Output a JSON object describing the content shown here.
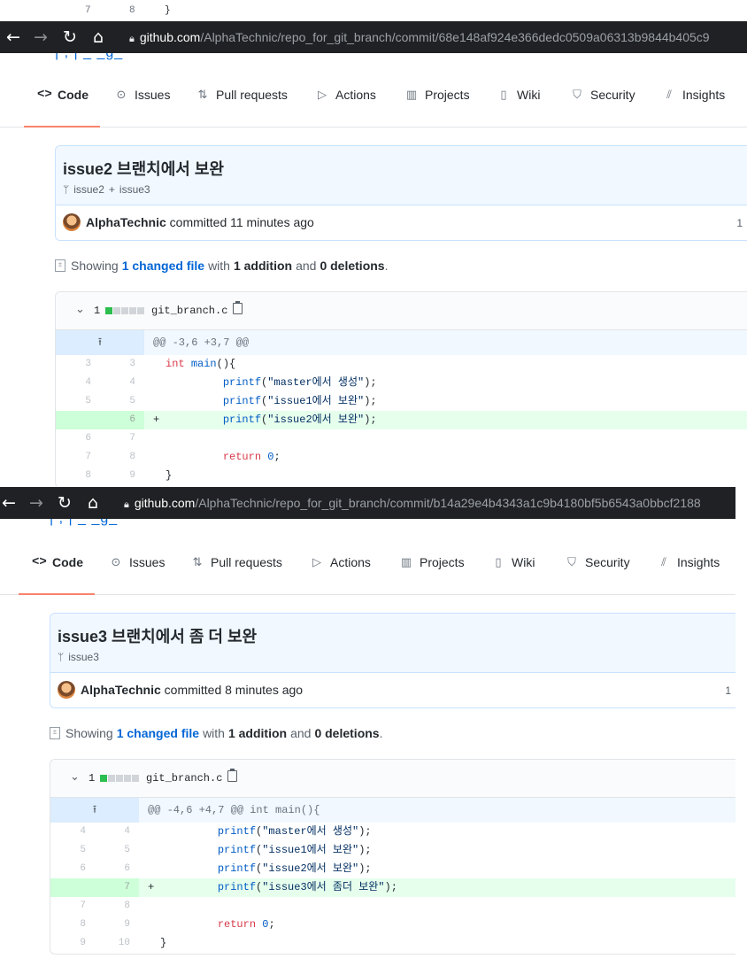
{
  "shot1": {
    "fragment": {
      "old_line": "7",
      "new_line": "8",
      "code": "}"
    },
    "browser": {
      "icons": [
        "back-arrow-icon",
        "forward-arrow-icon",
        "reload-icon",
        "home-icon",
        "lock-icon"
      ],
      "url_host": "github.com",
      "url_path": "/AlphaTechnic/repo_for_git_branch/commit/68e148af924e366dedc0509a06313b9844b405c9"
    },
    "tabs": [
      {
        "label": "Code",
        "icon": "code-icon"
      },
      {
        "label": "Issues",
        "icon": "issue-opened-icon"
      },
      {
        "label": "Pull requests",
        "icon": "git-pull-request-icon"
      },
      {
        "label": "Actions",
        "icon": "play-icon"
      },
      {
        "label": "Projects",
        "icon": "project-icon"
      },
      {
        "label": "Wiki",
        "icon": "book-icon"
      },
      {
        "label": "Security",
        "icon": "shield-icon"
      },
      {
        "label": "Insights",
        "icon": "graph-icon"
      }
    ],
    "commit": {
      "title": "issue2 브랜치에서 보완",
      "branches": [
        "issue2",
        "issue3"
      ],
      "branch_separator": "+",
      "author": "AlphaTechnic",
      "action": "committed",
      "time": "11 minutes ago",
      "parents": "1"
    },
    "summary": {
      "showing": "Showing",
      "changed": "1 changed file",
      "with": "with",
      "additions": "1 addition",
      "and": "and",
      "deletions": "0 deletions",
      "period": "."
    },
    "file": {
      "count": "1",
      "name": "git_branch.c",
      "blocks": [
        "added",
        "neutral",
        "neutral",
        "neutral",
        "neutral"
      ]
    },
    "hunk": {
      "expand_icon": "⭱",
      "header": "@@ -3,6 +3,7 @@"
    },
    "lines": [
      {
        "old": "3",
        "new": "3",
        "sign": "",
        "type": "context",
        "indent": "",
        "parts": [
          {
            "c": "kw",
            "t": "int"
          },
          {
            "c": "",
            "t": " "
          },
          {
            "c": "fn",
            "t": "main"
          },
          {
            "c": "",
            "t": "(){"
          }
        ]
      },
      {
        "old": "4",
        "new": "4",
        "sign": "",
        "type": "context",
        "indent": "         ",
        "parts": [
          {
            "c": "fn",
            "t": "printf"
          },
          {
            "c": "",
            "t": "("
          },
          {
            "c": "st",
            "t": "\"master에서 생성\""
          },
          {
            "c": "",
            "t": ");"
          }
        ]
      },
      {
        "old": "5",
        "new": "5",
        "sign": "",
        "type": "context",
        "indent": "         ",
        "parts": [
          {
            "c": "fn",
            "t": "printf"
          },
          {
            "c": "",
            "t": "("
          },
          {
            "c": "st",
            "t": "\"issue1에서 보완\""
          },
          {
            "c": "",
            "t": ");"
          }
        ]
      },
      {
        "old": "",
        "new": "6",
        "sign": "+",
        "type": "add",
        "indent": "         ",
        "parts": [
          {
            "c": "fn",
            "t": "printf"
          },
          {
            "c": "",
            "t": "("
          },
          {
            "c": "st",
            "t": "\"issue2에서 보완\""
          },
          {
            "c": "",
            "t": ");"
          }
        ]
      },
      {
        "old": "6",
        "new": "7",
        "sign": "",
        "type": "context",
        "indent": "",
        "parts": []
      },
      {
        "old": "7",
        "new": "8",
        "sign": "",
        "type": "context",
        "indent": "         ",
        "parts": [
          {
            "c": "kw",
            "t": "return"
          },
          {
            "c": "",
            "t": " "
          },
          {
            "c": "fn",
            "t": "0"
          },
          {
            "c": "",
            "t": ";"
          }
        ]
      },
      {
        "old": "8",
        "new": "9",
        "sign": "",
        "type": "context",
        "indent": "",
        "parts": [
          {
            "c": "",
            "t": "}"
          }
        ]
      }
    ]
  },
  "shot2": {
    "browser": {
      "icons": [
        "back-arrow-icon",
        "forward-arrow-icon",
        "reload-icon",
        "home-icon",
        "lock-icon"
      ],
      "url_host": "github.com",
      "url_path": "/AlphaTechnic/repo_for_git_branch/commit/b14a29e4b4343a1c9b4180bf5b6543a0bbcf2188"
    },
    "tabs": [
      {
        "label": "Code",
        "icon": "code-icon"
      },
      {
        "label": "Issues",
        "icon": "issue-opened-icon"
      },
      {
        "label": "Pull requests",
        "icon": "git-pull-request-icon"
      },
      {
        "label": "Actions",
        "icon": "play-icon"
      },
      {
        "label": "Projects",
        "icon": "project-icon"
      },
      {
        "label": "Wiki",
        "icon": "book-icon"
      },
      {
        "label": "Security",
        "icon": "shield-icon"
      },
      {
        "label": "Insights",
        "icon": "graph-icon"
      }
    ],
    "commit": {
      "title": "issue3 브랜치에서 좀 더 보완",
      "branches": [
        "issue3"
      ],
      "author": "AlphaTechnic",
      "action": "committed",
      "time": "8 minutes ago",
      "parents": "1"
    },
    "summary": {
      "showing": "Showing",
      "changed": "1 changed file",
      "with": "with",
      "additions": "1 addition",
      "and": "and",
      "deletions": "0 deletions",
      "period": "."
    },
    "file": {
      "count": "1",
      "name": "git_branch.c",
      "blocks": [
        "added",
        "neutral",
        "neutral",
        "neutral",
        "neutral"
      ]
    },
    "hunk": {
      "expand_icon": "⭱",
      "header": "@@ -4,6 +4,7 @@ int main(){"
    },
    "lines": [
      {
        "old": "4",
        "new": "4",
        "sign": "",
        "type": "context",
        "indent": "         ",
        "parts": [
          {
            "c": "fn",
            "t": "printf"
          },
          {
            "c": "",
            "t": "("
          },
          {
            "c": "st",
            "t": "\"master에서 생성\""
          },
          {
            "c": "",
            "t": ");"
          }
        ]
      },
      {
        "old": "5",
        "new": "5",
        "sign": "",
        "type": "context",
        "indent": "         ",
        "parts": [
          {
            "c": "fn",
            "t": "printf"
          },
          {
            "c": "",
            "t": "("
          },
          {
            "c": "st",
            "t": "\"issue1에서 보완\""
          },
          {
            "c": "",
            "t": ");"
          }
        ]
      },
      {
        "old": "6",
        "new": "6",
        "sign": "",
        "type": "context",
        "indent": "         ",
        "parts": [
          {
            "c": "fn",
            "t": "printf"
          },
          {
            "c": "",
            "t": "("
          },
          {
            "c": "st",
            "t": "\"issue2에서 보완\""
          },
          {
            "c": "",
            "t": ");"
          }
        ]
      },
      {
        "old": "",
        "new": "7",
        "sign": "+",
        "type": "add",
        "indent": "         ",
        "parts": [
          {
            "c": "fn",
            "t": "printf"
          },
          {
            "c": "",
            "t": "("
          },
          {
            "c": "st",
            "t": "\"issue3에서 좀더 보완\""
          },
          {
            "c": "",
            "t": ");"
          }
        ]
      },
      {
        "old": "7",
        "new": "8",
        "sign": "",
        "type": "context",
        "indent": "",
        "parts": []
      },
      {
        "old": "8",
        "new": "9",
        "sign": "",
        "type": "context",
        "indent": "         ",
        "parts": [
          {
            "c": "kw",
            "t": "return"
          },
          {
            "c": "",
            "t": " "
          },
          {
            "c": "fn",
            "t": "0"
          },
          {
            "c": "",
            "t": ";"
          }
        ]
      },
      {
        "old": "9",
        "new": "10",
        "sign": "",
        "type": "context",
        "indent": "",
        "parts": [
          {
            "c": "",
            "t": "}"
          }
        ]
      }
    ]
  },
  "colors": {
    "addition_bg": "#e6ffed",
    "addition_gutter": "#cdffd8",
    "hunk_bg": "#f1f8ff",
    "link": "#0366d6",
    "selected_tab_underline": "#f9826c",
    "address_bar": "#202124"
  }
}
